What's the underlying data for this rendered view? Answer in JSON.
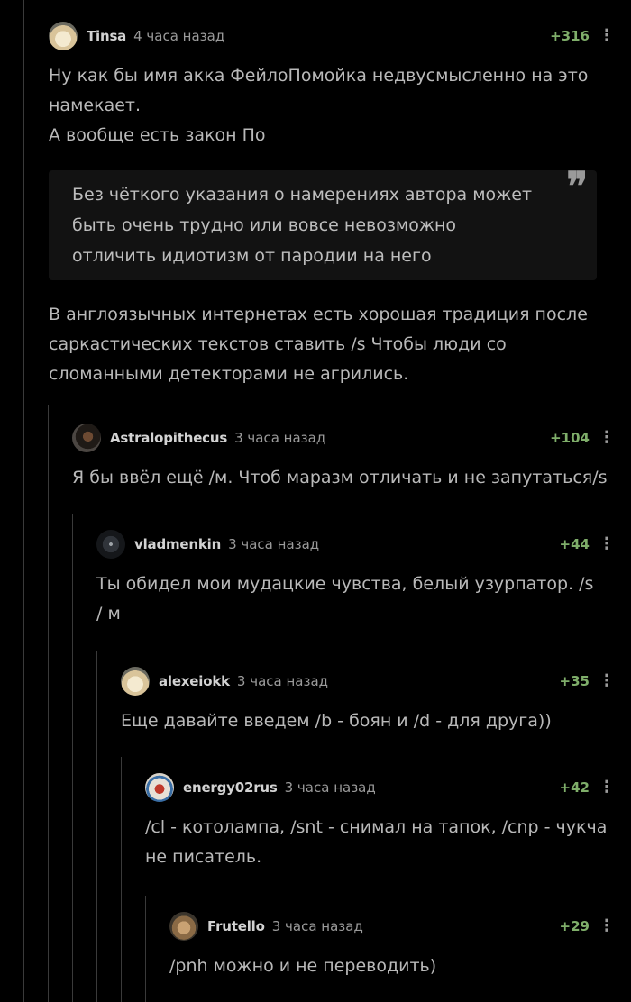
{
  "comments": [
    {
      "author": "Tinsa",
      "time": "4 часа назад",
      "rating": "+316",
      "paragraphs": [
        "Ну как бы имя акка ФейлоПомойка недвусмысленно на это намекает.",
        "А вообще есть закон По"
      ],
      "quote": "Без чёткого указания о намерениях автора может быть очень трудно или вовсе невозможно отличить идиотизм от пародии на него",
      "after_quote": "В англоязычных интернетах есть хорошая традиция после саркастических текстов ставить /s Чтобы люди со сломанными детекторами не агрились."
    },
    {
      "author": "Astralopithecus",
      "time": "3 часа назад",
      "rating": "+104",
      "paragraphs": [
        "Я бы ввёл ещё /м. Чтоб маразм отличать и не запутаться/s"
      ]
    },
    {
      "author": "vladmenkin",
      "time": "3 часа назад",
      "rating": "+44",
      "paragraphs": [
        "Ты обидел мои мудацкие чувства, белый узурпатор. /s / м"
      ]
    },
    {
      "author": "alexeiokk",
      "time": "3 часа назад",
      "rating": "+35",
      "paragraphs": [
        "Еще давайте введем /b - боян и /d - для друга))"
      ]
    },
    {
      "author": "energy02rus",
      "time": "3 часа назад",
      "rating": "+42",
      "paragraphs": [
        "/cl - котолампа, /snt - снимал на тапок, /cnp - чукча не писатель."
      ]
    },
    {
      "author": "Frutello",
      "time": "3 часа назад",
      "rating": "+29",
      "paragraphs": [
        "/pnh можно и не переводить)"
      ]
    }
  ],
  "more_glyph": "⋮",
  "quote_glyph": "❞",
  "colors": {
    "background": "#000000",
    "text": "#b9b9b9",
    "rating": "#7fae6a",
    "thread_line": "#3a3a3a",
    "quote_bg": "#121212"
  }
}
